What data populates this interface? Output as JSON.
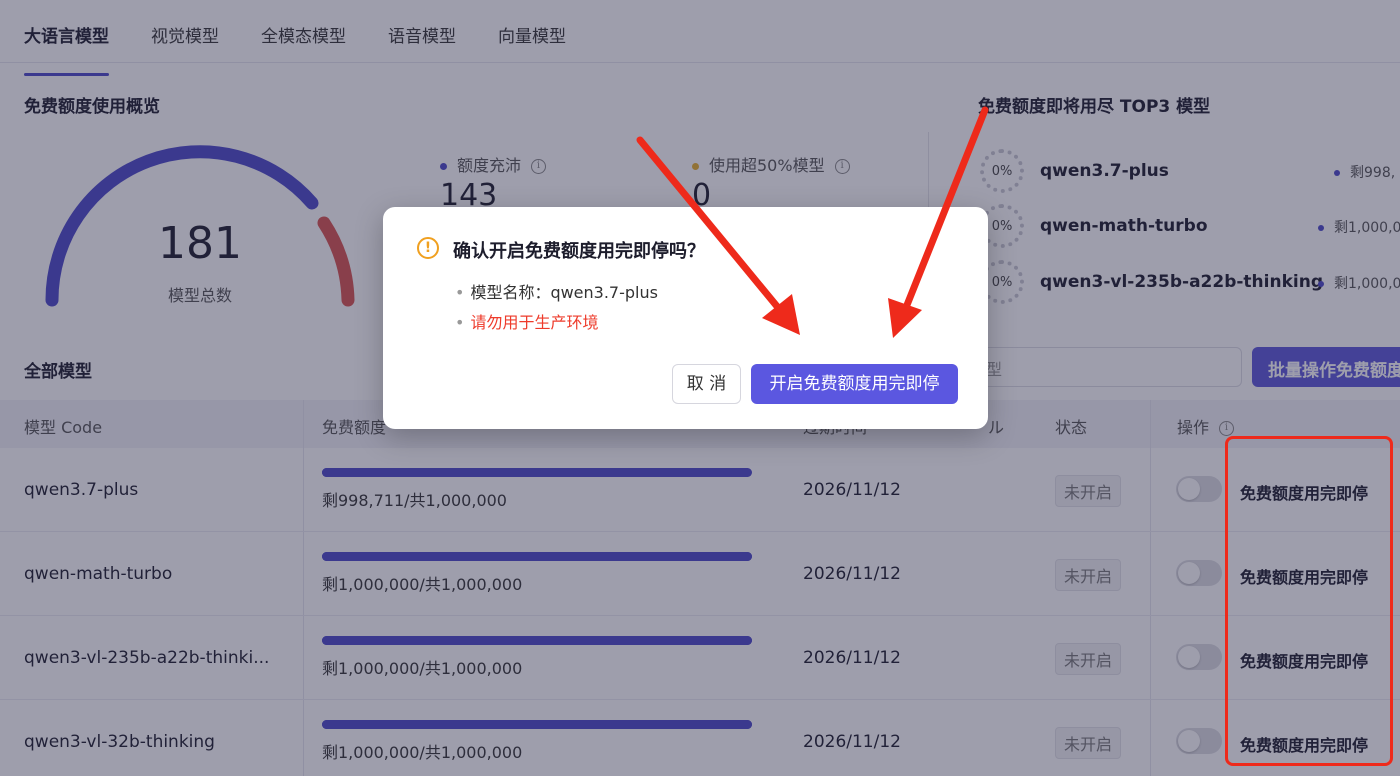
{
  "tabs": [
    "大语言模型",
    "视觉模型",
    "全模态模型",
    "语音模型",
    "向量模型"
  ],
  "overview": {
    "title": "免费额度使用概览",
    "total_value": "181",
    "total_label": "模型总数",
    "stats": [
      {
        "label": "额度充沛",
        "value": "143",
        "color": "#4b48c8"
      },
      {
        "label": "使用超50%模型",
        "value": "0",
        "color": "#e8b02a"
      }
    ]
  },
  "top3": {
    "title": "免费额度即将用尽 TOP3 模型",
    "items": [
      {
        "percent": "0%",
        "name": "qwen3.7-plus",
        "remaining": "剩998,"
      },
      {
        "percent": "0%",
        "name": "qwen-math-turbo",
        "remaining": "剩1,000,0"
      },
      {
        "percent": "0%",
        "name": "qwen3-vl-235b-a22b-thinking",
        "remaining": "剩1,000,0"
      }
    ]
  },
  "all_models": {
    "title": "全部模型",
    "search_placeholder": "型",
    "batch_button": "批量操作免费额度"
  },
  "table": {
    "headers": {
      "code": "模型 Code",
      "quota": "免费额度",
      "expire": "过期时间",
      "col_partial": "ル",
      "status": "状态",
      "action": "操作"
    },
    "rows": [
      {
        "code": "qwen3.7-plus",
        "remaining": "剩998,711/共1,000,000",
        "fraction": 0.9987,
        "date": "2026/11/12",
        "status": "未开启",
        "action": "免费额度用完即停"
      },
      {
        "code": "qwen-math-turbo",
        "remaining": "剩1,000,000/共1,000,000",
        "fraction": 1.0,
        "date": "2026/11/12",
        "status": "未开启",
        "action": "免费额度用完即停"
      },
      {
        "code": "qwen3-vl-235b-a22b-thinki...",
        "remaining": "剩1,000,000/共1,000,000",
        "fraction": 1.0,
        "date": "2026/11/12",
        "status": "未开启",
        "action": "免费额度用完即停"
      },
      {
        "code": "qwen3-vl-32b-thinking",
        "remaining": "剩1,000,000/共1,000,000",
        "fraction": 1.0,
        "date": "2026/11/12",
        "status": "未开启",
        "action": "免费额度用完即停"
      }
    ]
  },
  "modal": {
    "title": "确认开启免费额度用完即停吗？",
    "model_line": "模型名称：qwen3.7-plus",
    "warning_line": "请勿用于生产环境",
    "cancel": "取 消",
    "confirm": "开启免费额度用完即停"
  },
  "colors": {
    "accent": "#5b57e0",
    "warning": "#ee2a1b"
  }
}
